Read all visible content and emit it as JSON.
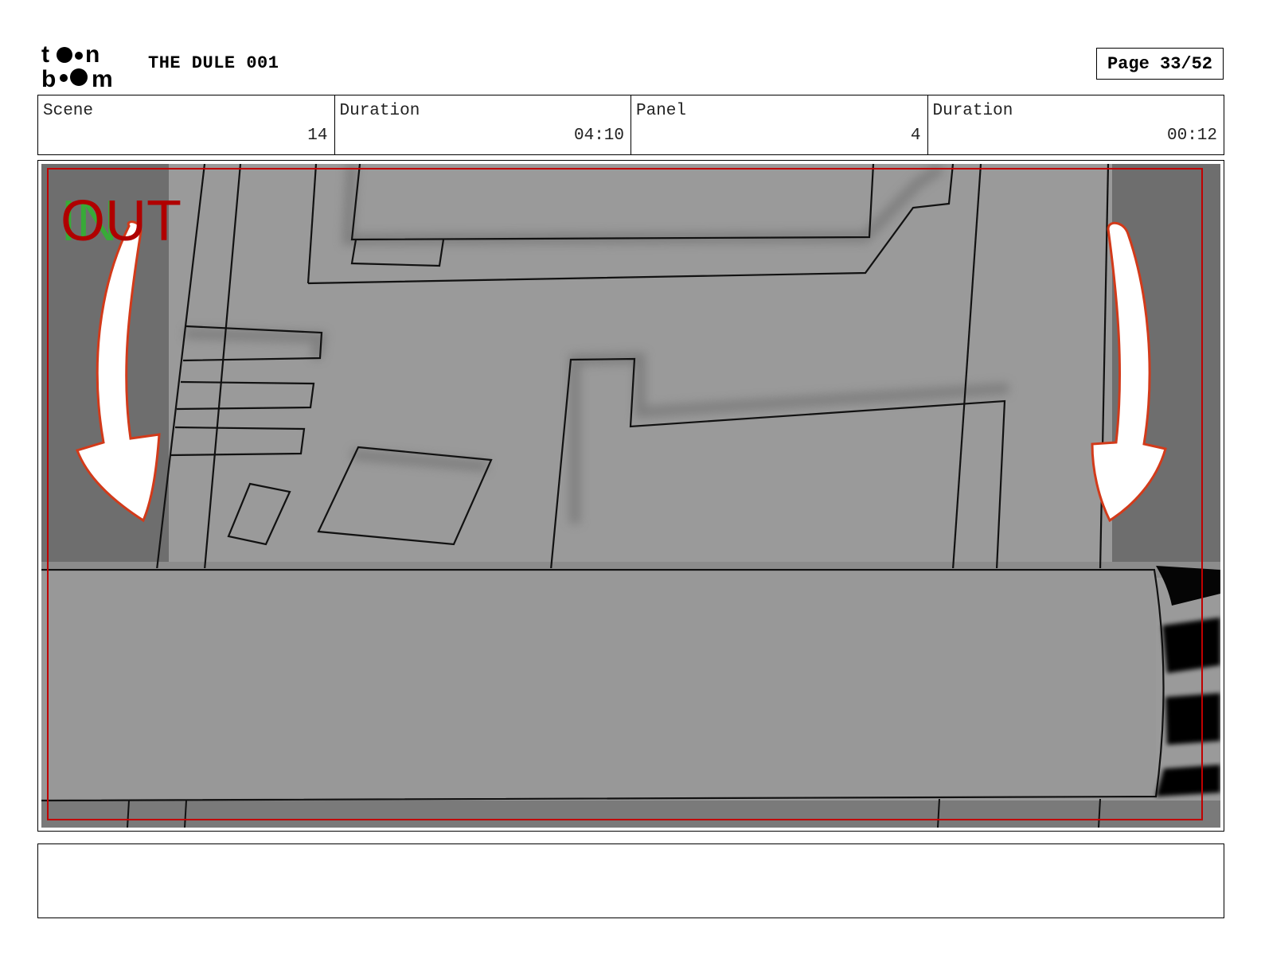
{
  "header": {
    "logo_text": "toon boom",
    "title": "THE DULE 001",
    "page": "Page 33/52"
  },
  "info": {
    "scene_label": "Scene",
    "scene_value": "14",
    "scene_duration_label": "Duration",
    "scene_duration_value": "04:10",
    "panel_label": "Panel",
    "panel_value": "4",
    "panel_duration_label": "Duration",
    "panel_duration_value": "00:12"
  },
  "panel": {
    "in_marker": "IN",
    "out_marker": "OUT",
    "in_color": "#2fb52f",
    "out_color": "#b00000",
    "safe_frame_color": "#c00000"
  },
  "notes": {
    "text": ""
  }
}
